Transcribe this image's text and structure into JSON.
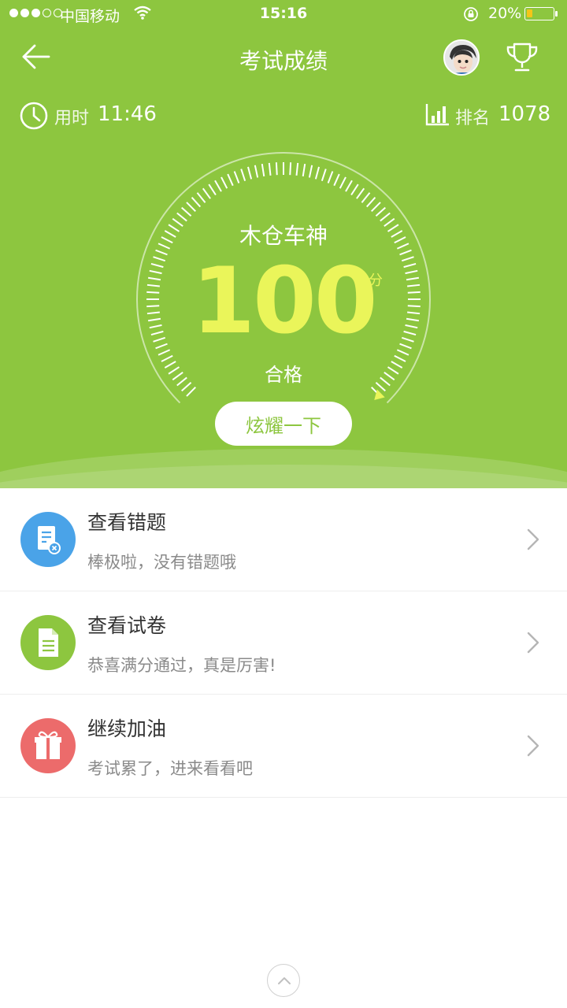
{
  "status_bar": {
    "carrier": "中国移动",
    "time": "15:16",
    "battery": "20%",
    "signal_strength": 3,
    "signal_max": 5
  },
  "nav": {
    "title": "考试成绩",
    "back_icon": "arrow-left-icon",
    "trophy_icon": "trophy-icon"
  },
  "stats": {
    "time_label": "用时",
    "time_value": "11:46",
    "rank_label": "排名",
    "rank_value": "1078"
  },
  "result": {
    "title": "木仓车神",
    "score": "100",
    "unit": "分",
    "status": "合格",
    "gauge_fraction": 1.0
  },
  "share_button": "炫耀一下",
  "list": [
    {
      "title": "查看错题",
      "subtitle": "棒极啦，没有错题哦",
      "icon": "wrong-questions-icon",
      "color": "#4aa3e8"
    },
    {
      "title": "查看试卷",
      "subtitle": "恭喜满分通过，真是厉害!",
      "icon": "document-icon",
      "color": "#8dc63f"
    },
    {
      "title": "继续加油",
      "subtitle": "考试累了，进来看看吧",
      "icon": "gift-icon",
      "color": "#ec6b6b"
    }
  ],
  "colors": {
    "primary": "#8dc63f",
    "score": "#eaf55a"
  }
}
